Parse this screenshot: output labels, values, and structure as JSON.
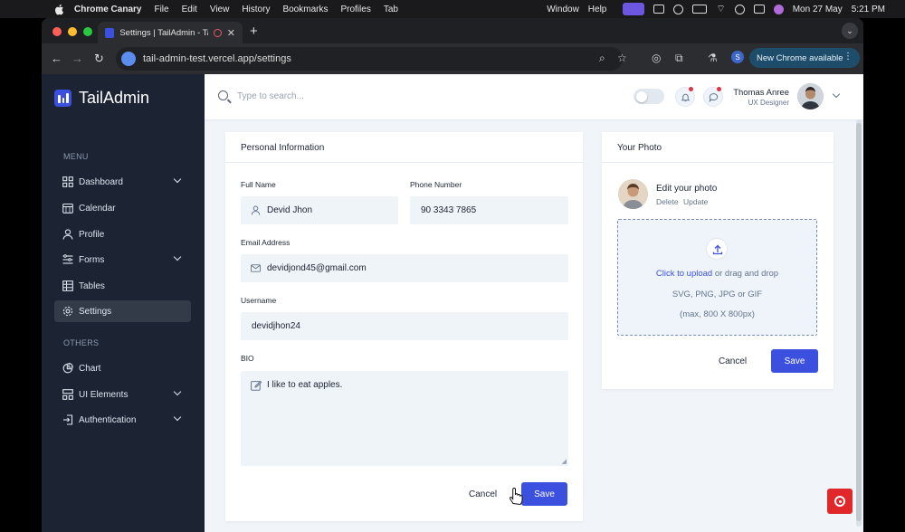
{
  "menubar": {
    "app": "Chrome Canary",
    "items": [
      "File",
      "Edit",
      "View",
      "History",
      "Bookmarks",
      "Profiles",
      "Tab"
    ],
    "right_items": [
      "Window",
      "Help"
    ],
    "datetime": "Mon 27 May",
    "time": "5:21 PM"
  },
  "browser": {
    "tab_title": "Settings | TailAdmin - Tail",
    "url": "tail-admin-test.vercel.app/settings",
    "profile_initial": "S",
    "update_label": "New Chrome available"
  },
  "sidebar": {
    "brand": "TailAdmin",
    "menu_label": "MENU",
    "others_label": "OTHERS",
    "menu_items": [
      {
        "label": "Dashboard",
        "icon": "grid-icon"
      },
      {
        "label": "Calendar",
        "icon": "calendar-icon"
      },
      {
        "label": "Profile",
        "icon": "user-icon"
      },
      {
        "label": "Forms",
        "icon": "forms-icon"
      },
      {
        "label": "Tables",
        "icon": "table-icon"
      },
      {
        "label": "Settings",
        "icon": "gear-icon"
      }
    ],
    "other_items": [
      {
        "label": "Chart",
        "icon": "pie-chart-icon"
      },
      {
        "label": "UI Elements",
        "icon": "layers-icon"
      },
      {
        "label": "Authentication",
        "icon": "login-icon"
      }
    ]
  },
  "header": {
    "search_placeholder": "Type to search...",
    "user_name": "Thomas Anree",
    "user_role": "UX Designer"
  },
  "personal": {
    "title": "Personal Information",
    "full_name_label": "Full Name",
    "full_name": "Devid Jhon",
    "phone_label": "Phone Number",
    "phone": "90 3343 7865",
    "email_label": "Email Address",
    "email": "devidjond45@gmail.com",
    "username_label": "Username",
    "username": "devidjhon24",
    "bio_label": "BIO",
    "bio": "I like to eat apples.",
    "cancel": "Cancel",
    "save": "Save"
  },
  "photo": {
    "title": "Your Photo",
    "edit": "Edit your photo",
    "delete": "Delete",
    "update": "Update",
    "upload_link": "Click to upload",
    "upload_rest": " or drag and drop",
    "formats": "SVG, PNG, JPG or GIF",
    "max": "(max, 800 X 800px)",
    "cancel": "Cancel",
    "save": "Save"
  },
  "colors": {
    "sidebar_bg": "#1c2434",
    "primary": "#3c50e0",
    "page_bg": "#f1f5f9",
    "record": "#e0272a"
  }
}
